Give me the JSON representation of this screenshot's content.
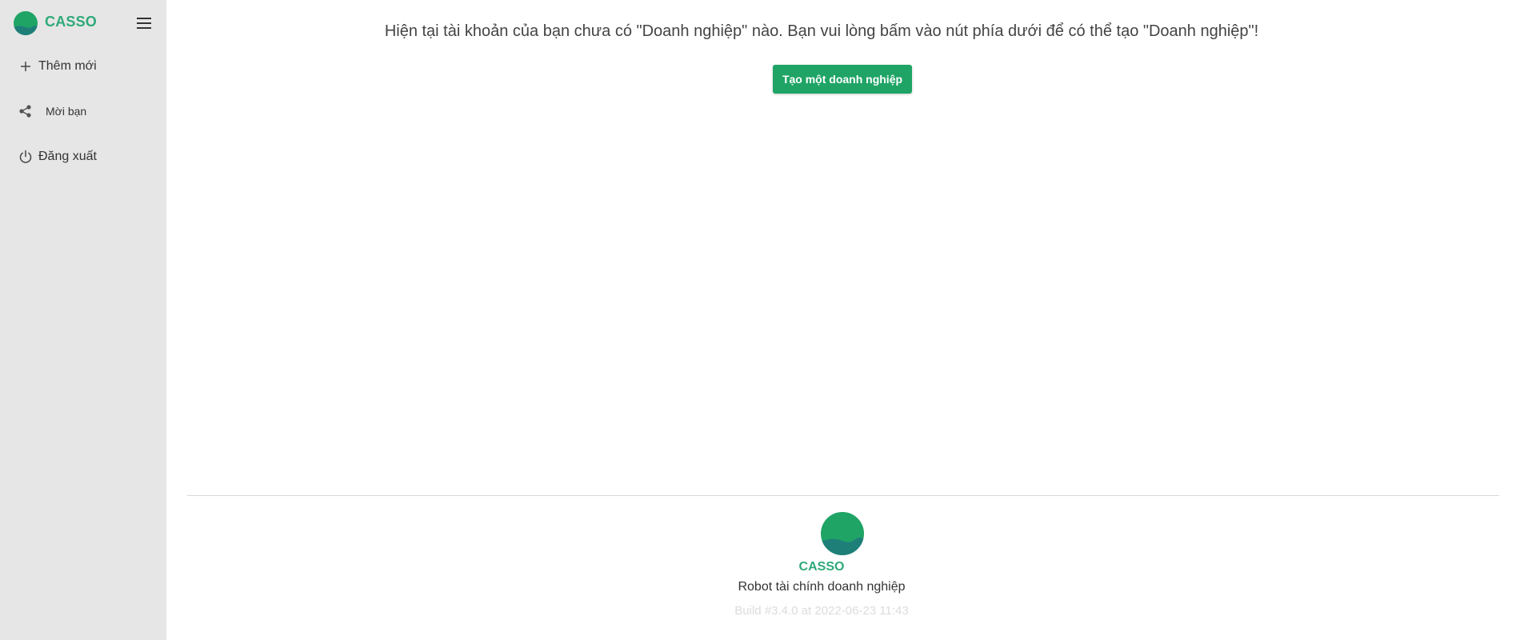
{
  "brand": {
    "name": "CASSO",
    "color": "#2fa97a"
  },
  "sidebar": {
    "background": "#e6e6e6",
    "menu_icon": "hamburger-menu-icon",
    "items": [
      {
        "label": "Thêm mới",
        "icon": "plus-icon"
      },
      {
        "label": "Mời bạn",
        "icon": "share-icon"
      },
      {
        "label": "Đăng xuất",
        "icon": "power-icon"
      }
    ]
  },
  "main": {
    "notice": "Hiện tại tài khoản của bạn chưa có \"Doanh nghiệp\" nào. Bạn vui lòng bấm vào nút phía dưới để có thể tạo \"Doanh nghiệp\"!",
    "create_button_label": "Tạo một doanh nghiệp",
    "button_color": "#1fa466"
  },
  "footer": {
    "brand": "CASSO",
    "tagline": "Robot tài chính doanh nghiệp",
    "build": "Build #3.4.0 at 2022-06-23 11:43"
  }
}
